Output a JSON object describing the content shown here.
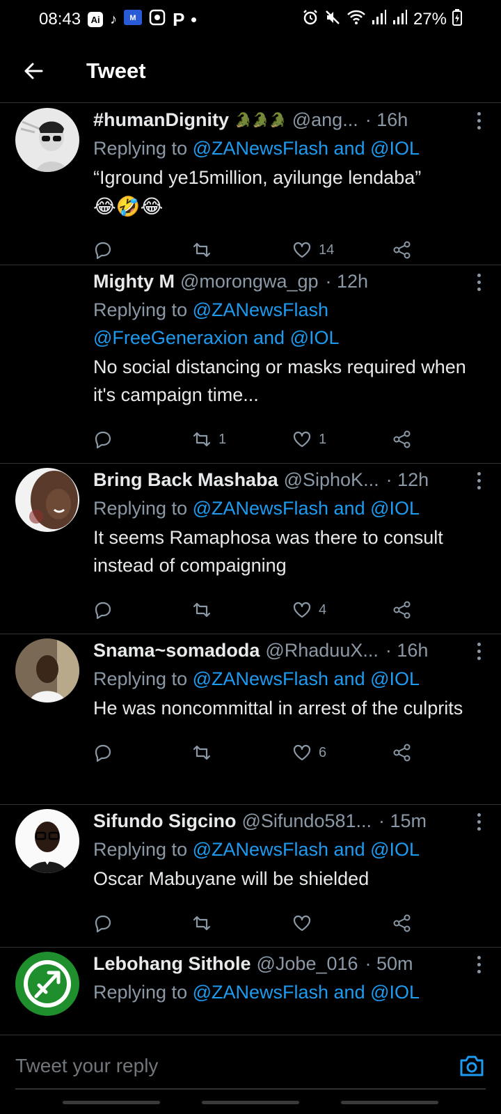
{
  "status_bar": {
    "time": "08:43",
    "app_icons": [
      "Ai",
      "tiktok-icon",
      "mvmovies-icon",
      "camera-app-icon",
      "p-app-icon"
    ],
    "battery": "27%"
  },
  "header": {
    "title": "Tweet",
    "back_icon": "arrow-left-icon"
  },
  "tweets": [
    {
      "name": "#humanDignity",
      "emoji": "🐊🐊🐊",
      "handle": "@ang...",
      "time": "· 16h",
      "reply_prefix": "Replying to ",
      "reply_mentions": "@ZANewsFlash and @IOL",
      "text": "“Iground ye15million, ayilunge lendaba”",
      "text_emoji": "😂🤣😂",
      "replies": "",
      "retweets": "",
      "likes": "14"
    },
    {
      "name": "Mighty M",
      "handle": "@morongwa_gp",
      "time": "· 12h",
      "reply_prefix": "Replying to ",
      "reply_mentions": "@ZANewsFlash\n@FreeGeneraxion and @IOL",
      "text": "No social distancing or masks required when it's campaign time...",
      "replies": "",
      "retweets": "1",
      "likes": "1"
    },
    {
      "name": "Bring Back Mashaba",
      "handle": "@SiphoK...",
      "time": "· 12h",
      "reply_prefix": "Replying to ",
      "reply_mentions": "@ZANewsFlash and @IOL",
      "text": "It seems Ramaphosa was there to consult instead of compaigning",
      "replies": "",
      "retweets": "",
      "likes": "4"
    },
    {
      "name": "Snama~somadoda",
      "handle": "@RhaduuX...",
      "time": "· 16h",
      "reply_prefix": "Replying to ",
      "reply_mentions": "@ZANewsFlash and @IOL",
      "text": "He was noncommittal in arrest of the culprits",
      "replies": "",
      "retweets": "",
      "likes": "6"
    },
    {
      "name": "Sifundo Sigcino",
      "handle": "@Sifundo581...",
      "time": "· 15m",
      "reply_prefix": "Replying to ",
      "reply_mentions": "@ZANewsFlash and @IOL",
      "text": "Oscar Mabuyane will be shielded",
      "replies": "",
      "retweets": "",
      "likes": ""
    },
    {
      "name": "Lebohang Sithole",
      "handle": "@Jobe_016",
      "time": "· 50m",
      "reply_prefix": "Replying to ",
      "reply_mentions": "@ZANewsFlash and @IOL",
      "text": "",
      "replies": "",
      "retweets": "",
      "likes": ""
    }
  ],
  "reply_bar": {
    "placeholder": "Tweet your reply",
    "camera_icon": "camera-icon"
  },
  "colors": {
    "background": "#000000",
    "accent": "#1d9bf0",
    "muted": "#8b98a5",
    "divider": "#2f3336"
  }
}
